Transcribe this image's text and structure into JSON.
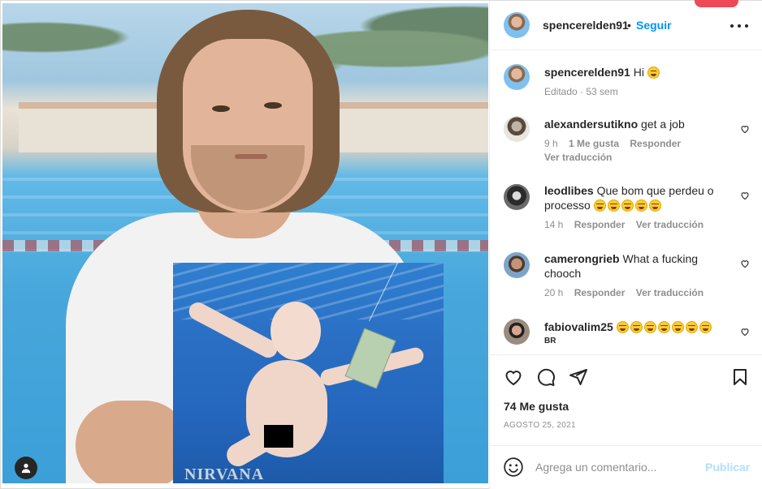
{
  "post": {
    "username": "spencerelden91",
    "follow_label": "Seguir",
    "separator": "•"
  },
  "caption": {
    "username": "spencerelden91",
    "text": "Hi",
    "meta": "Editado · 53 sem"
  },
  "comments": [
    {
      "username": "alexandersutikno",
      "text": "get a job",
      "time": "9 h",
      "likes": "1 Me gusta",
      "reply": "Responder",
      "translate": "Ver traducción"
    },
    {
      "username": "leodlibes",
      "text": "Que bom que perdeu o processo",
      "emoji_count": 5,
      "time": "14 h",
      "reply": "Responder",
      "translate": "Ver traducción"
    },
    {
      "username": "camerongrieb",
      "text": "What a fucking chooch",
      "time": "20 h",
      "reply": "Responder",
      "translate": "Ver traducción"
    },
    {
      "username": "fabiovalim25",
      "text": "",
      "emoji_count": 7,
      "subtext": "BR"
    }
  ],
  "footer": {
    "likes": "74 Me gusta",
    "date": "AGOSTO 25, 2021"
  },
  "composer": {
    "placeholder": "Agrega un comentario...",
    "post_label": "Publicar"
  },
  "album": {
    "text": "NIRVANA"
  },
  "icons": {
    "more": "more-options-icon",
    "like": "heart-icon",
    "comment": "comment-icon",
    "share": "share-icon",
    "save": "bookmark-icon",
    "emoji": "emoji-icon",
    "tag": "user-tag-icon"
  },
  "colors": {
    "link": "#0095f6",
    "text": "#262626",
    "muted": "#8e8e8e",
    "post_disabled": "#b2dffc",
    "notification": "#ed4956"
  }
}
